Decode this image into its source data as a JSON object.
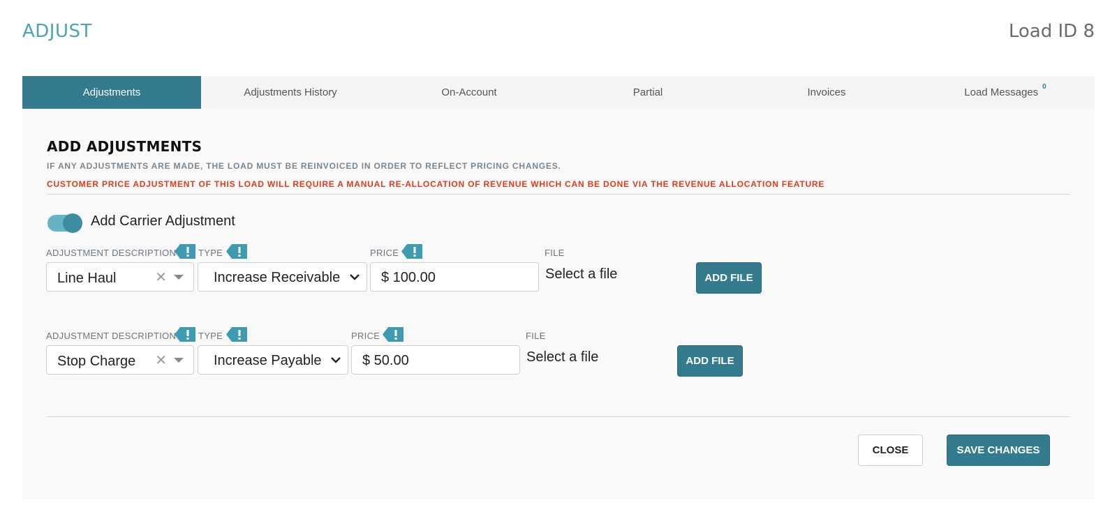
{
  "header": {
    "title": "ADJUST",
    "load_id": "Load ID 8"
  },
  "tabs": [
    {
      "label": "Adjustments",
      "active": true
    },
    {
      "label": "Adjustments History"
    },
    {
      "label": "On-Account"
    },
    {
      "label": "Partial"
    },
    {
      "label": "Invoices"
    },
    {
      "label": "Load Messages",
      "badge": "0"
    }
  ],
  "panel": {
    "title": "ADD ADJUSTMENTS",
    "note": "IF ANY ADJUSTMENTS ARE MADE, THE LOAD MUST BE REINVOICED IN ORDER TO REFLECT PRICING CHANGES.",
    "warning": "CUSTOMER PRICE ADJUSTMENT OF THIS LOAD WILL REQUIRE A MANUAL RE-ALLOCATION OF REVENUE WHICH CAN BE DONE VIA THE REVENUE ALLOCATION FEATURE",
    "toggle_label": "Add Carrier Adjustment",
    "toggle_on": true
  },
  "labels": {
    "description": "ADJUSTMENT DESCRIPTION",
    "type": "TYPE",
    "price": "PRICE",
    "file": "FILE"
  },
  "rows": [
    {
      "description": "Line Haul",
      "type": "Increase Receivable",
      "price": "$ 100.00",
      "file": "Select a file",
      "add_file": "ADD FILE"
    },
    {
      "description": "Stop Charge",
      "type": "Increase Payable",
      "price": "$ 50.00",
      "file": "Select a file",
      "add_file": "ADD FILE"
    }
  ],
  "footer": {
    "close": "CLOSE",
    "save": "SAVE CHANGES"
  },
  "colors": {
    "accent": "#337b8d",
    "accent_light": "#4aa3b6",
    "warning": "#e03c1c"
  }
}
